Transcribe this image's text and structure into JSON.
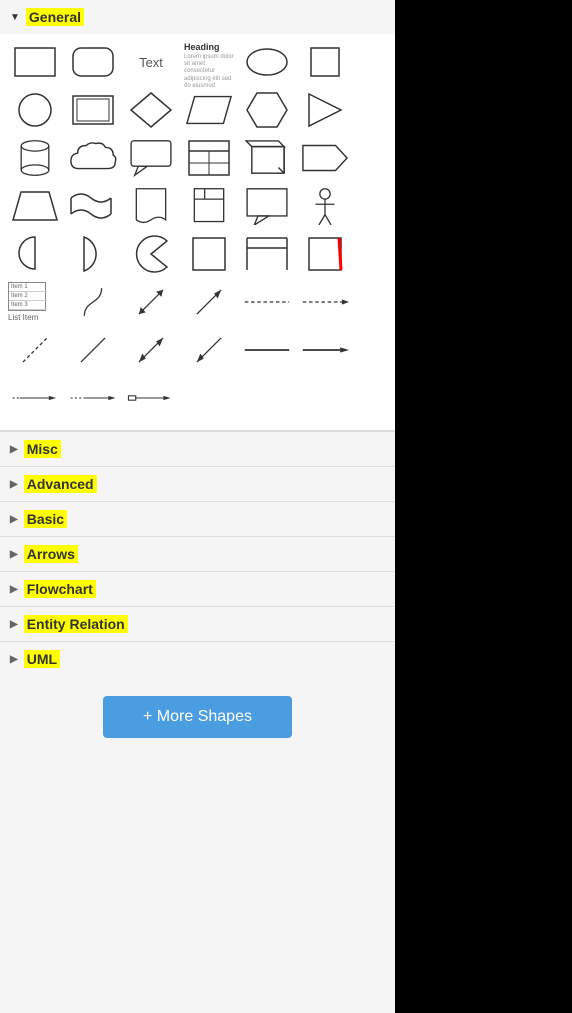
{
  "panel": {
    "sections": [
      {
        "id": "general",
        "label": "General",
        "expanded": true
      },
      {
        "id": "misc",
        "label": "Misc",
        "expanded": false
      },
      {
        "id": "advanced",
        "label": "Advanced",
        "expanded": false
      },
      {
        "id": "basic",
        "label": "Basic",
        "expanded": false
      },
      {
        "id": "arrows",
        "label": "Arrows",
        "expanded": false
      },
      {
        "id": "flowchart",
        "label": "Flowchart",
        "expanded": false
      },
      {
        "id": "entity-relation",
        "label": "Entity Relation",
        "expanded": false
      },
      {
        "id": "uml",
        "label": "UML",
        "expanded": false
      }
    ],
    "more_shapes_label": "+ More Shapes"
  }
}
